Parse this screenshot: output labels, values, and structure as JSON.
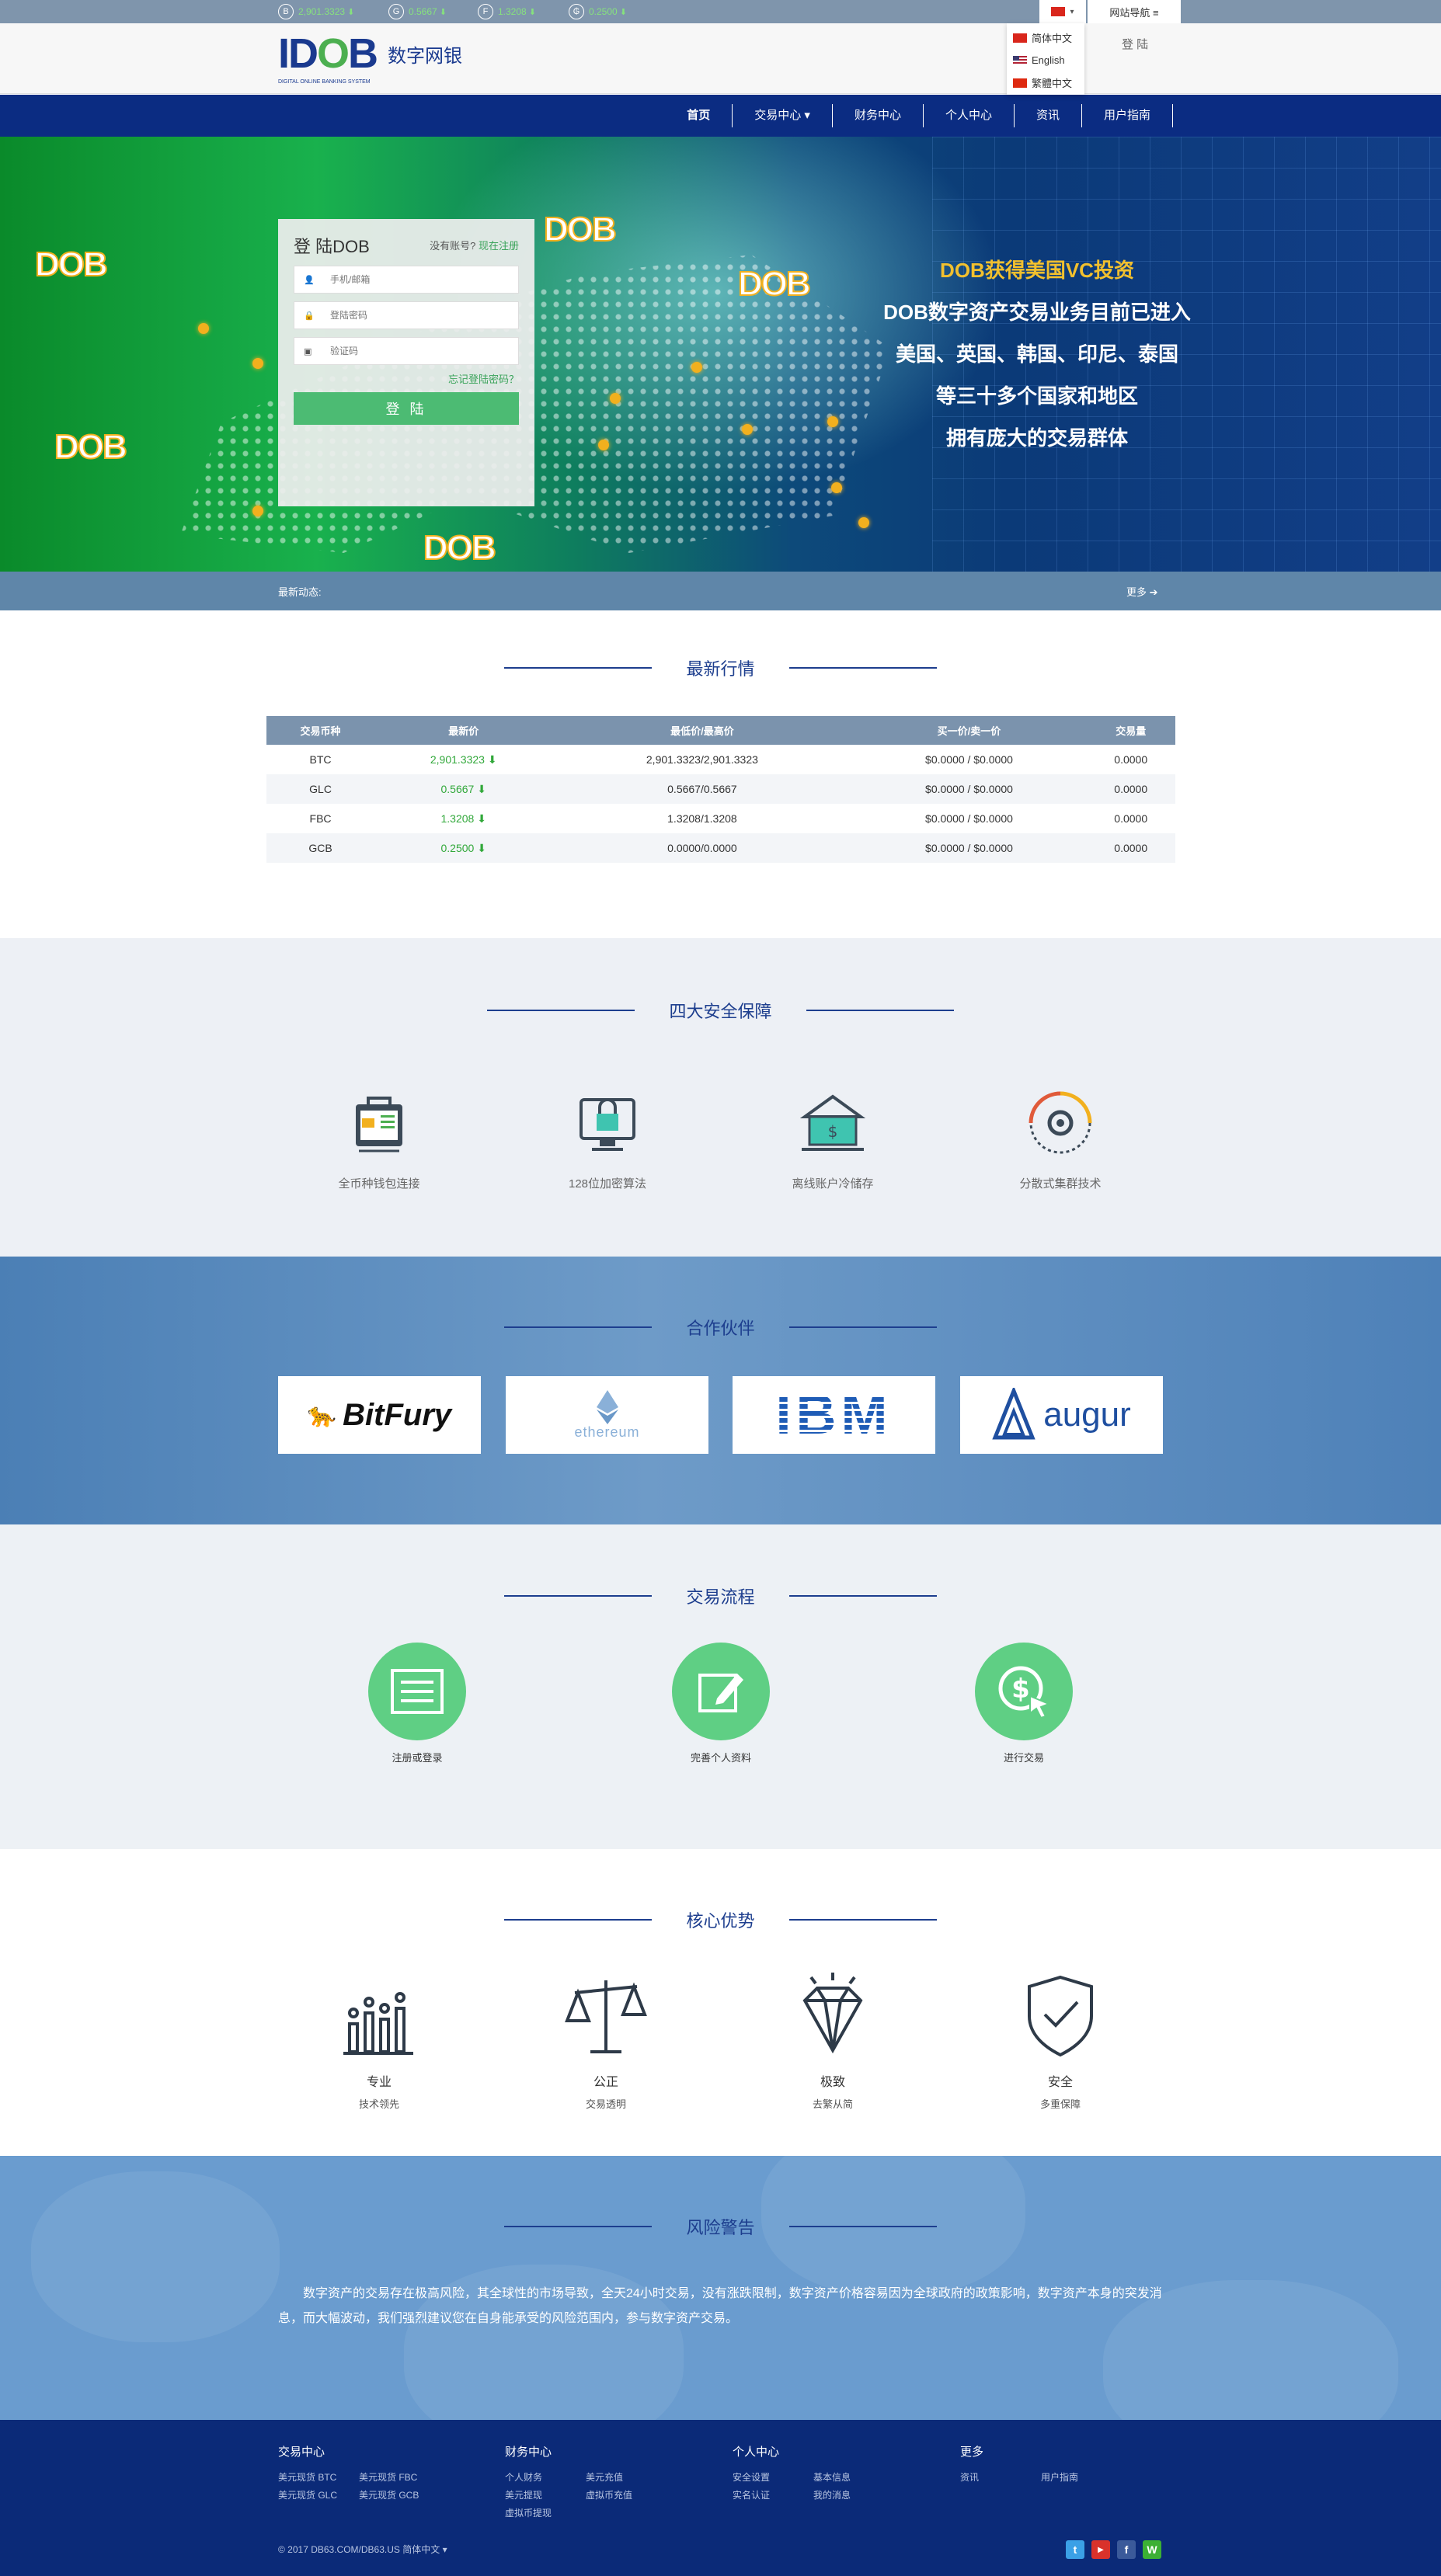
{
  "ticker": [
    {
      "coin": "B",
      "value": "2,901.3323",
      "arrow": "⬇"
    },
    {
      "coin": "G",
      "value": "0.5667",
      "arrow": "⬇"
    },
    {
      "coin": "F",
      "value": "1.3208",
      "arrow": "⬇"
    },
    {
      "coin": "₲",
      "value": "0.2500",
      "arrow": "⬇"
    }
  ],
  "top": {
    "lang_flag_caret": "▾",
    "site_nav": "网站导航 ≡",
    "login": "登 陆"
  },
  "languages": [
    "简体中文",
    "English",
    "繁體中文"
  ],
  "logo": {
    "mark_a": "D",
    "mark_b": "O",
    "mark_c": "B",
    "prefix": "I",
    "tagline": "DIGITAL ONLINE BANKING SYSTEM",
    "name": "数字网银"
  },
  "nav": [
    "首页",
    "交易中心 ▾",
    "财务中心",
    "个人中心",
    "资讯",
    "用户指南"
  ],
  "hero": {
    "lines": [
      "DOB获得美国VC投资",
      "DOB数字资产交易业务目前已进入",
      "美国、英国、韩国、印尼、泰国",
      "等三十多个国家和地区",
      "拥有庞大的交易群体"
    ],
    "badge": "DOB"
  },
  "login": {
    "title": "登 陆DOB",
    "no_account": "没有账号?",
    "register": "现在注册",
    "phone_placeholder": "手机/邮箱",
    "password_placeholder": "登陆密码",
    "captcha_placeholder": "验证码",
    "forgot": "忘记登陆密码？",
    "submit": "登 陆"
  },
  "news": {
    "label": "最新动态:",
    "more": "更多 ➔"
  },
  "market": {
    "title": "最新行情",
    "headers": [
      "交易币种",
      "最新价",
      "最低价/最高价",
      "买一价/卖一价",
      "交易量"
    ],
    "rows": [
      {
        "coin": "BTC",
        "price": "2,901.3323 ⬇",
        "range": "2,901.3323/2,901.3323",
        "bidask": "$0.0000 / $0.0000",
        "volume": "0.0000"
      },
      {
        "coin": "GLC",
        "price": "0.5667 ⬇",
        "range": "0.5667/0.5667",
        "bidask": "$0.0000 / $0.0000",
        "volume": "0.0000"
      },
      {
        "coin": "FBC",
        "price": "1.3208 ⬇",
        "range": "1.3208/1.3208",
        "bidask": "$0.0000 / $0.0000",
        "volume": "0.0000"
      },
      {
        "coin": "GCB",
        "price": "0.2500 ⬇",
        "range": "0.0000/0.0000",
        "bidask": "$0.0000 / $0.0000",
        "volume": "0.0000"
      }
    ]
  },
  "security": {
    "title": "四大安全保障",
    "items": [
      "全币种钱包连接",
      "128位加密算法",
      "离线账户冷储存",
      "分散式集群技术"
    ]
  },
  "partners": {
    "title": "合作伙伴",
    "names": [
      "BitFury",
      "ethereum",
      "IBM",
      "augur"
    ]
  },
  "process": {
    "title": "交易流程",
    "steps": [
      "注册或登录",
      "完善个人资料",
      "进行交易"
    ]
  },
  "core": {
    "title": "核心优势",
    "items": [
      {
        "t1": "专业",
        "t2": "技术领先"
      },
      {
        "t1": "公正",
        "t2": "交易透明"
      },
      {
        "t1": "极致",
        "t2": "去繁从简"
      },
      {
        "t1": "安全",
        "t2": "多重保障"
      }
    ]
  },
  "risk": {
    "title": "风险警告",
    "text": "数字资产的交易存在极高风险，其全球性的市场导致，全天24小时交易，没有涨跌限制，数字资产价格容易因为全球政府的政策影响，数字资产本身的突发消息，而大幅波动，我们强烈建议您在自身能承受的风险范围内，参与数字资产交易。"
  },
  "footer": {
    "cols": [
      {
        "title": "交易中心",
        "rows": [
          [
            "美元现货 BTC",
            "美元现货 FBC"
          ],
          [
            "美元现货 GLC",
            "美元现货 GCB"
          ]
        ]
      },
      {
        "title": "财务中心",
        "rows": [
          [
            "个人财务",
            "美元充值"
          ],
          [
            "美元提现",
            "虚拟币充值"
          ],
          [
            "虚拟币提现",
            ""
          ]
        ]
      },
      {
        "title": "个人中心",
        "rows": [
          [
            "安全设置",
            "基本信息"
          ],
          [
            "实名认证",
            "我的消息"
          ]
        ]
      },
      {
        "title": "更多",
        "rows": [
          [
            "资讯",
            "用户指南"
          ]
        ]
      }
    ],
    "copyright": "© 2017 DB63.COM/DB63.US 简体中文 ▾",
    "social": [
      "t",
      "▶",
      "f",
      "W"
    ]
  },
  "colors": {
    "nav": "#0b2c82",
    "accent_green": "#4cbb73",
    "title_blue": "#1d3e8e",
    "footer": "#0b2a78"
  }
}
